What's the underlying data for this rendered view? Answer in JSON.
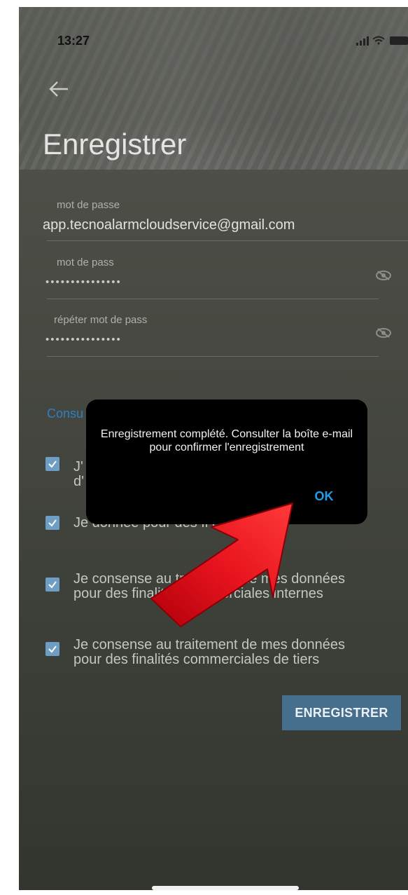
{
  "status_bar": {
    "time": "13:27"
  },
  "header": {
    "title": "Enregistrer"
  },
  "form": {
    "fields": [
      {
        "label": "mot de passe",
        "value": "app.tecnoalarmcloudservice@gmail.com"
      },
      {
        "label": "mot de pass",
        "value": "•••••••••••••••"
      },
      {
        "label": "répéter mot de pass",
        "value": "•••••••••••••••"
      }
    ],
    "consult_link": "Consu",
    "checkboxes": [
      {
        "label": "J' d'",
        "checked": true
      },
      {
        "label": "Je donnée pour des fi e profilage",
        "checked": true
      },
      {
        "label": "Je consense au traitement de mes données pour des finalités commerciales internes",
        "checked": true
      },
      {
        "label": "Je consense au traitement de mes données pour des finalités commerciales de tiers",
        "checked": true
      }
    ],
    "submit_label": "ENREGISTRER"
  },
  "dialog": {
    "message": "Enregistrement complété. Consulter la boîte e-mail pour confirmer l'enregistrement",
    "ok_label": "OK"
  },
  "colors": {
    "accent": "#1f9de9",
    "checkbox": "#6e9ec3",
    "button_bg": "#466f8d",
    "arrow": "#e0121c"
  }
}
